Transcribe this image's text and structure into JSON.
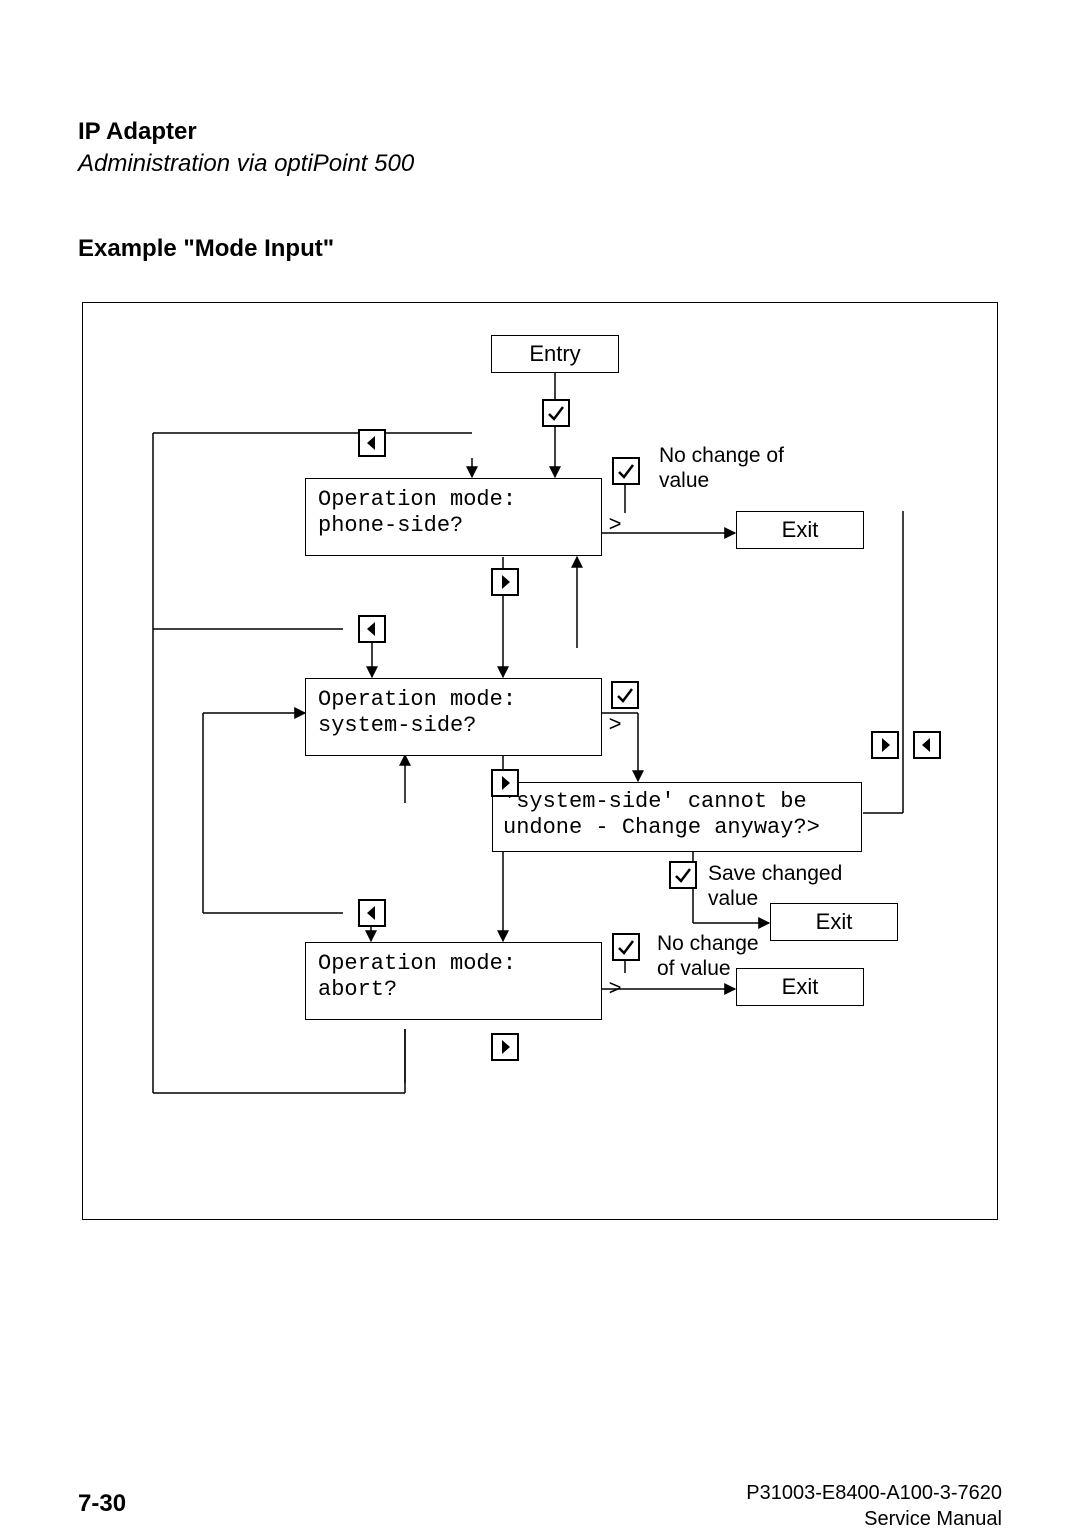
{
  "header": {
    "title": "IP Adapter",
    "subtitle": "Administration via optiPoint 500"
  },
  "section_title": "Example \"Mode Input\"",
  "diagram": {
    "entry": "Entry",
    "phone_side_line1": "Operation mode:",
    "phone_side_line2": "phone-side?           >",
    "system_side_line1": "Operation mode:",
    "system_side_line2": "system-side?          >",
    "confirm_line1": "'system-side' cannot be",
    "confirm_line2": "undone - Change anyway?>",
    "abort_line1": "Operation mode:",
    "abort_line2": "abort?                >",
    "exit1": "Exit",
    "exit2": "Exit",
    "exit3": "Exit",
    "no_change_line1": "No change of",
    "no_change_line2": "value",
    "no_change2_line1": "No change",
    "no_change2_line2": "of value",
    "save_line1": "Save changed",
    "save_line2": "value"
  },
  "footer": {
    "page": "7-30",
    "docnum": "P31003-E8400-A100-3-7620",
    "doctype": "Service Manual"
  }
}
